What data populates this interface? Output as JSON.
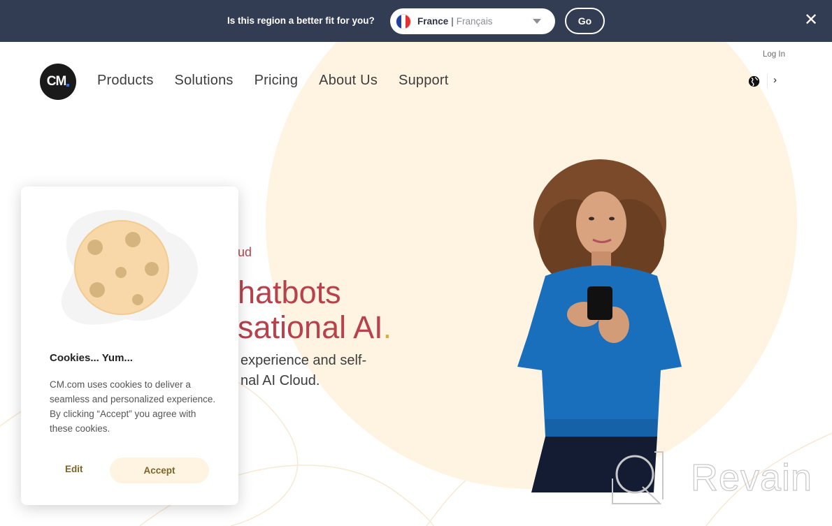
{
  "region_banner": {
    "question": "Is this region a better fit for you?",
    "country": "France",
    "separator": "|",
    "language": "Français",
    "go_label": "Go",
    "close_label": "✕",
    "flag_colors": [
      "#1f3e9e",
      "#ffffff",
      "#e4302f"
    ]
  },
  "header": {
    "logo_text": "CM",
    "nav": [
      "Products",
      "Solutions",
      "Pricing",
      "About Us",
      "Support"
    ],
    "login_label": "Log In",
    "globe_icon": "globe-icon",
    "chevron_label": "›"
  },
  "hero": {
    "kicker": "ud",
    "heading_line1": "hatbots",
    "heading_line2": "sational AI",
    "heading_dot": ".",
    "subtitle_line1": "experience and self-",
    "subtitle_line2": "nal AI Cloud."
  },
  "cookie_banner": {
    "title": "Cookies... Yum...",
    "body": "CM.com uses cookies to deliver a seamless and personalized experience. By clicking “Accept” you agree with these cookies.",
    "edit_label": "Edit",
    "accept_label": "Accept"
  },
  "watermark": {
    "text": "Revain"
  },
  "colors": {
    "banner_bg": "#323c52",
    "accent_red": "#b8414c",
    "accent_gold": "#d8ac3a",
    "cream": "#fef4e1",
    "button_text": "#7a6427"
  }
}
